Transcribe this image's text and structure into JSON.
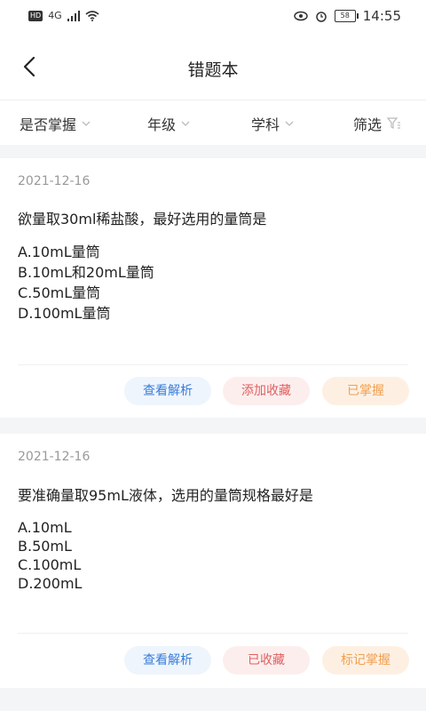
{
  "status": {
    "network": "4G",
    "hd": "HD",
    "battery": "58",
    "time": "14:55"
  },
  "header": {
    "title": "错题本"
  },
  "filters": [
    {
      "label": "是否掌握"
    },
    {
      "label": "年级"
    },
    {
      "label": "学科"
    },
    {
      "label": "筛选"
    }
  ],
  "questions": [
    {
      "date": "2021-12-16",
      "text": "欲量取30ml稀盐酸，最好选用的量筒是",
      "options": [
        "A.10mL量筒",
        "B.10mL和20mL量筒",
        "C.50mL量筒",
        "D.100mL量筒"
      ],
      "actions": {
        "analysis": "查看解析",
        "favorite": "添加收藏",
        "mastered": "已掌握"
      }
    },
    {
      "date": "2021-12-16",
      "text": "要准确量取95mL液体，选用的量筒规格最好是",
      "options": [
        "A.10mL",
        "B.50mL",
        "C.100mL",
        "D.200mL"
      ],
      "actions": {
        "analysis": "查看解析",
        "favorite": "已收藏",
        "mastered": "标记掌握"
      }
    }
  ]
}
